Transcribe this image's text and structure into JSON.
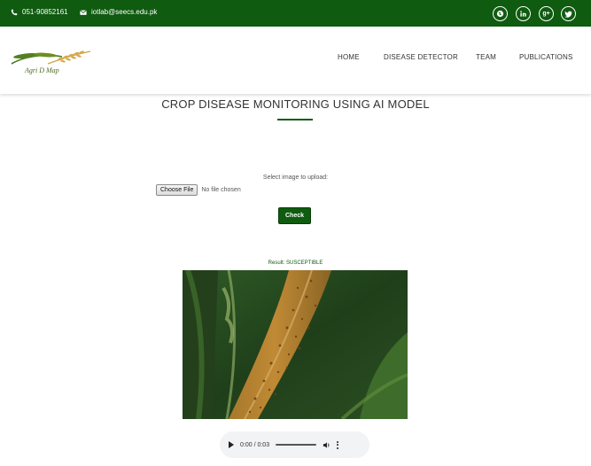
{
  "topbar": {
    "phone": "051-90852161",
    "email": "iotlab@seecs.edu.pk",
    "social_icons": [
      "globe-icon",
      "linkedin-icon",
      "google-plus-icon",
      "twitter-icon"
    ],
    "google_plus_text": "g+"
  },
  "header": {
    "logo_text": "Agri D Map",
    "nav": [
      "HOME",
      "DISEASE DETECTOR",
      "TEAM",
      "PUBLICATIONS"
    ]
  },
  "main": {
    "title": "CROP DISEASE MONITORING USING AI MODEL",
    "upload_label": "Select image to upload:",
    "choose_file_label": "Choose File",
    "no_file_text": "No file chosen",
    "check_label": "Check",
    "result_text": "Result: SUSCEPTIBLE"
  },
  "audio": {
    "time": "0:00 / 0:03"
  },
  "colors": {
    "brand_green": "#0f5b10",
    "white": "#ffffff"
  }
}
